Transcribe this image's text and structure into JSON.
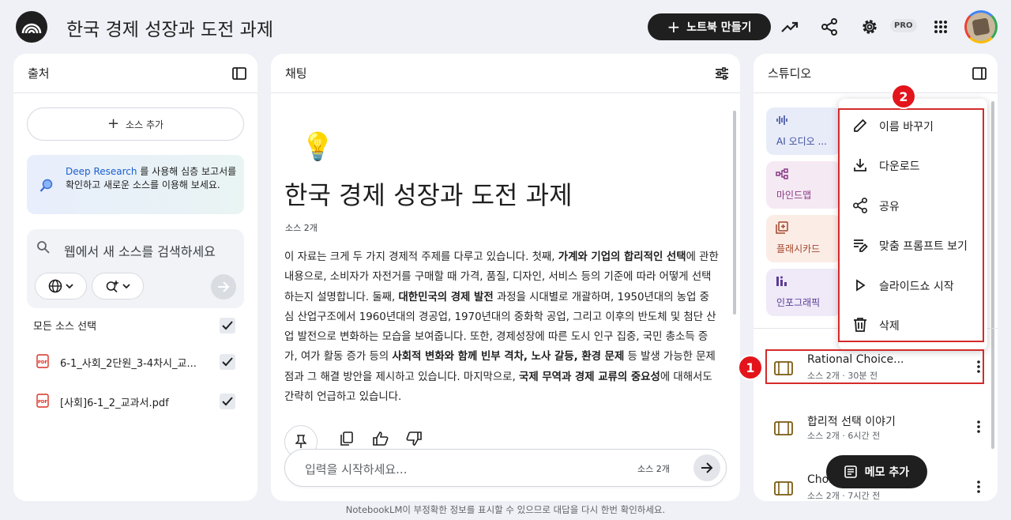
{
  "app": {
    "title": "한국 경제 성장과 도전 과제",
    "new_notebook_label": "노트북 만들기",
    "pro_badge": "PRO"
  },
  "sources": {
    "header": "출처",
    "add_label": "소스 추가",
    "deep_research": {
      "link": "Deep Research",
      "text": " 를 사용해 심층 보고서를 확인하고 새로운 소스를 이용해 보세요."
    },
    "search_placeholder": "웹에서 새 소스를 검색하세요",
    "select_all": "모든 소스 선택",
    "items": [
      {
        "name": "6-1_사회_2단원_3-4차시_교...",
        "icon": "pdf-icon"
      },
      {
        "name": "[사회]6-1_2_교과서.pdf",
        "icon": "pdf-icon"
      }
    ]
  },
  "chat": {
    "header": "채팅",
    "emoji": "💡",
    "title": "한국 경제 성장과 도전 과제",
    "source_count": "소스 2개",
    "summary": [
      {
        "t": "이 자료는 크게 두 가지 경제적 주제를 다루고 있습니다. 첫째, ",
        "b": false
      },
      {
        "t": "가계와 기업의 합리적인 선택",
        "b": true
      },
      {
        "t": "에 관한 내용으로, 소비자가 자전거를 구매할 때 가격, 품질, 디자인, 서비스 등의 기준에 따라 어떻게 선택하는지 설명합니다. 둘째, ",
        "b": false
      },
      {
        "t": "대한민국의 경제 발전",
        "b": true
      },
      {
        "t": " 과정을 시대별로 개괄하며, 1950년대의 농업 중심 산업구조에서 1960년대의 경공업, 1970년대의 중화학 공업, 그리고 이후의 반도체 및 첨단 산업 발전으로 변화하는 모습을 보여줍니다. 또한, 경제성장에 따른 도시 인구 집중, 국민 총소득 증가, 여가 활동 증가 등의 ",
        "b": false
      },
      {
        "t": "사회적 변화와 함께 빈부 격차, 노사 갈등, 환경 문제",
        "b": true
      },
      {
        "t": " 등 발생 가능한 문제점과 그 해결 방안을 제시하고 있습니다. 마지막으로, ",
        "b": false
      },
      {
        "t": "국제 무역과 경제 교류의 중요성",
        "b": true
      },
      {
        "t": "에 대해서도 간략히 언급하고 있습니다.",
        "b": false
      }
    ],
    "input_placeholder": "입력을 시작하세요...",
    "input_source_count": "소스 2개"
  },
  "studio": {
    "header": "스튜디오",
    "tiles": [
      {
        "label": "AI 오디오 ...",
        "icon": "audio-wave-icon",
        "bg": "#e8ecf9",
        "fg": "#3b4fa0"
      },
      {
        "label": "마인드맵",
        "icon": "mindmap-icon",
        "bg": "#f5e9f4",
        "fg": "#8a3b84"
      },
      {
        "label": "플래시카드",
        "icon": "flashcard-icon",
        "bg": "#fbece6",
        "fg": "#a3462a"
      },
      {
        "label": "인포그래픽",
        "icon": "infographic-icon",
        "bg": "#efe9f8",
        "fg": "#5b3c95"
      }
    ],
    "notes": [
      {
        "title": "Rational Choice...",
        "subtitle": "소스 2개 · 30분 전"
      },
      {
        "title": "합리적 선택 이야기",
        "subtitle": "소스 2개 · 6시간 전"
      },
      {
        "title": "Choi",
        "subtitle": "소스 2개 · 7시간 전"
      }
    ],
    "memo_label": "메모 추가"
  },
  "menu": {
    "items": [
      {
        "label": "이름 바꾸기",
        "icon": "pencil-icon"
      },
      {
        "label": "다운로드",
        "icon": "download-icon"
      },
      {
        "label": "공유",
        "icon": "share-icon"
      },
      {
        "label": "맞춤 프롬프트 보기",
        "icon": "prompt-icon"
      },
      {
        "label": "슬라이드쇼 시작",
        "icon": "play-icon"
      },
      {
        "label": "삭제",
        "icon": "trash-icon"
      }
    ]
  },
  "annotations": {
    "badge1": "1",
    "badge2": "2",
    "highlight_color": "#d42b2b"
  },
  "footer": "NotebookLM이 부정확한 정보를 표시할 수 있으므로 대답을 다시 한번 확인하세요."
}
